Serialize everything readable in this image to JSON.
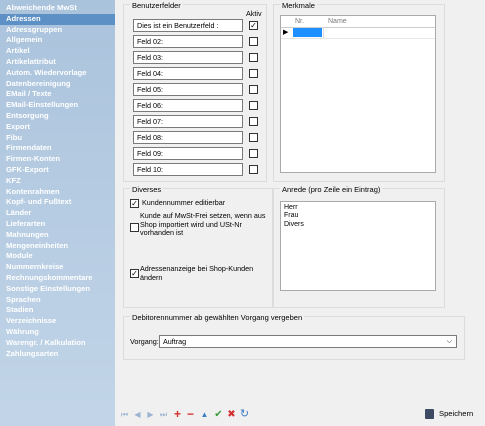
{
  "sidebar": {
    "items": [
      "Abweichende MwSt",
      "Adressen",
      "Adressgruppen",
      "Allgemein",
      "Artikel",
      "Artikelattribut",
      "Autom. Wiedervorlage",
      "Datenbereinigung",
      "EMail / Texte",
      "EMail-Einstellungen",
      "Entsorgung",
      "Export",
      "Fibu",
      "Firmendaten",
      "Firmen-Konten",
      "GFK-Export",
      "KFZ",
      "Kontenrahmen",
      "Kopf- und Fußtext",
      "Länder",
      "Lieferarten",
      "Mahnungen",
      "Mengeneinheiten",
      "Module",
      "Nummernkreise",
      "Rechnungskommentare",
      "Sonstige Einstellungen",
      "Sprachen",
      "Stadien",
      "Verzeichnisse",
      "Währung",
      "Warengr. / Kalkulation",
      "Zahlungsarten"
    ],
    "selected": "Adressen"
  },
  "benutzerfelder": {
    "title": "Benutzerfelder",
    "aktiv_label": "Aktiv",
    "fields": [
      {
        "value": "Dies ist ein Benutzerfeld   :",
        "checked": true
      },
      {
        "value": "Feld 02:",
        "checked": false
      },
      {
        "value": "Feld 03:",
        "checked": false
      },
      {
        "value": "Feld 04:",
        "checked": false
      },
      {
        "value": "Feld 05:",
        "checked": false
      },
      {
        "value": "Feld 06:",
        "checked": false
      },
      {
        "value": "Feld 07:",
        "checked": false
      },
      {
        "value": "Feld 08:",
        "checked": false
      },
      {
        "value": "Feld 09:",
        "checked": false
      },
      {
        "value": "Feld 10:",
        "checked": false
      }
    ]
  },
  "merkmale": {
    "title": "Merkmale",
    "col_nr": "Nr.",
    "col_name": "Name",
    "row_marker": "▶"
  },
  "diverses": {
    "title": "Diverses",
    "opt1": {
      "label": "Kundennummer editierbar",
      "checked": true
    },
    "opt2": {
      "label": "Kunde auf MwSt-Frei setzen, wenn aus Shop importiert wird und USt-Nr vorhanden ist",
      "checked": false
    },
    "opt3": {
      "label": "Adressenanzeige bei Shop-Kunden ändern",
      "checked": true
    }
  },
  "anrede": {
    "title": "Anrede (pro Zeile ein Eintrag)",
    "entries": [
      "Herr",
      "Frau",
      "Divers"
    ]
  },
  "debitor": {
    "title": "Debitorennummer ab gewählten Vorgang vergeben",
    "vorgang_label": "Vorgang:",
    "vorgang_value": "Auftrag"
  },
  "toolbar": {
    "save_label": "Speichern"
  },
  "colors": {
    "sidebar_selected": "#5d90c4",
    "grid_selected_cell": "#1e90ff",
    "add": "#d32f2f",
    "confirm": "#3a9d3a",
    "nav": "#3d7fc4"
  }
}
